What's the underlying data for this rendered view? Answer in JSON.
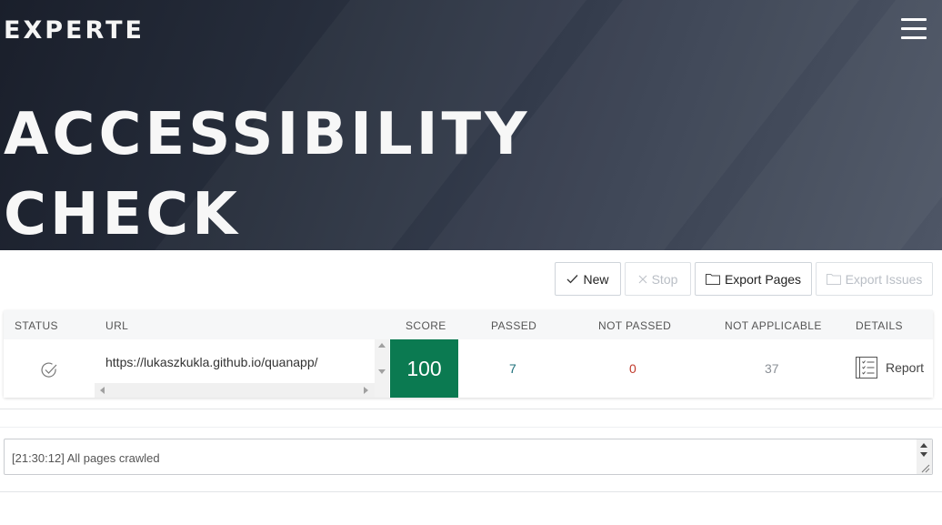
{
  "header": {
    "logo": "EXPERTE",
    "title_line1": "ACCESSIBILITY",
    "title_line2": "CHECK",
    "menu_icon": "hamburger-menu-icon"
  },
  "toolbar": {
    "new_label": "New",
    "stop_label": "Stop",
    "export_pages_label": "Export Pages",
    "export_issues_label": "Export Issues"
  },
  "table": {
    "columns": [
      "STATUS",
      "URL",
      "SCORE",
      "PASSED",
      "NOT PASSED",
      "NOT APPLICABLE",
      "DETAILS"
    ],
    "rows": [
      {
        "status_icon": "check-circle-icon",
        "url": "https://lukaszkukla.github.io/quanapp/",
        "score": "100",
        "passed": "7",
        "not_passed": "0",
        "not_applicable": "37",
        "details_label": "Report"
      }
    ]
  },
  "log": {
    "text": "[21:30:12] All pages crawled"
  },
  "colors": {
    "score_bg": "#0b7a51",
    "passed": "#1d6f7a",
    "not_passed": "#c0392b",
    "not_applicable": "#8a8f96"
  }
}
